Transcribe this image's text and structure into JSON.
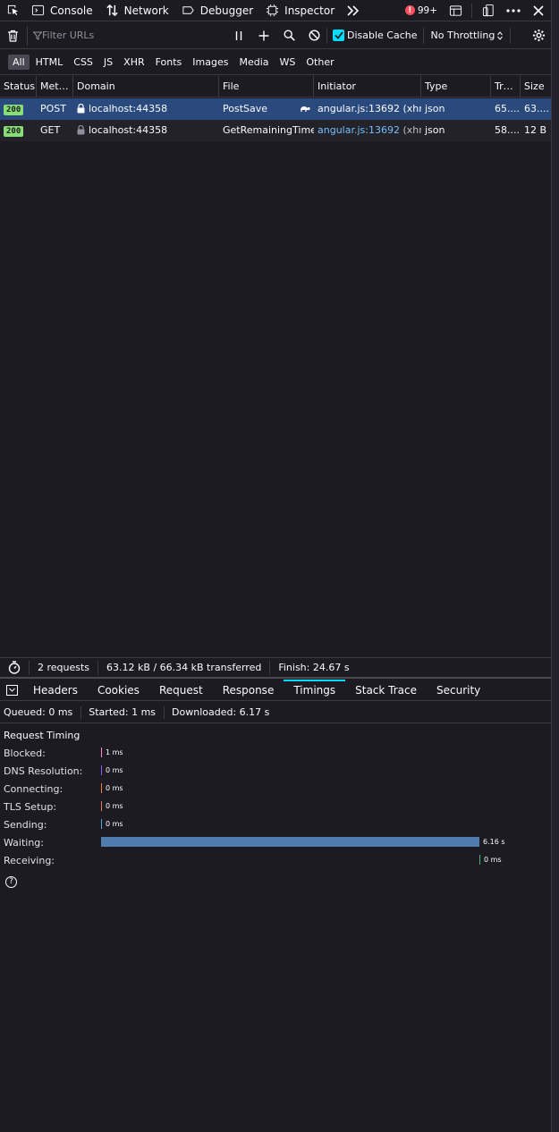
{
  "toolbox": {
    "tabs": [
      {
        "label": "Console",
        "icon": "console-icon"
      },
      {
        "label": "Network",
        "icon": "network-icon",
        "active": true
      },
      {
        "label": "Debugger",
        "icon": "debugger-icon"
      },
      {
        "label": "Inspector",
        "icon": "inspector-icon"
      }
    ],
    "error_count": "99+"
  },
  "filterbar": {
    "placeholder": "Filter URLs",
    "disable_cache_label": "Disable Cache",
    "disable_cache_checked": true,
    "throttling_label": "No Throttling"
  },
  "type_filters": [
    "All",
    "HTML",
    "CSS",
    "JS",
    "XHR",
    "Fonts",
    "Images",
    "Media",
    "WS",
    "Other"
  ],
  "table": {
    "columns": [
      "Status",
      "Met…",
      "Domain",
      "File",
      "Initiator",
      "Type",
      "Tr…",
      "Size"
    ],
    "rows": [
      {
        "status": "200",
        "method": "POST",
        "domain": "localhost:44358",
        "file": "PostSave",
        "initiator": "angular.js:13692",
        "initiator_suffix": "(xhr)",
        "type": "json",
        "transferred": "65....",
        "size": "63....",
        "selected": true
      },
      {
        "status": "200",
        "method": "GET",
        "domain": "localhost:44358",
        "file": "GetRemainingTimes",
        "initiator": "angular.js:13692",
        "initiator_suffix": "(xhr)",
        "type": "json",
        "transferred": "58....",
        "size": "12 B",
        "selected": false
      }
    ]
  },
  "summary": {
    "requests": "2 requests",
    "transferred": "63.12 kB / 66.34 kB transferred",
    "finish": "Finish: 24.67 s"
  },
  "details": {
    "tabs": [
      "Headers",
      "Cookies",
      "Request",
      "Response",
      "Timings",
      "Stack Trace",
      "Security"
    ],
    "active_tab": "Timings",
    "queued": "Queued: 0 ms",
    "started": "Started: 1 ms",
    "downloaded": "Downloaded: 6.17 s",
    "request_timing_title": "Request Timing",
    "timings": [
      {
        "label": "Blocked:",
        "value": "1 ms",
        "fraction": 0.0,
        "color": "#ff8bd2"
      },
      {
        "label": "DNS Resolution:",
        "value": "0 ms",
        "fraction": 0.0,
        "color": "#9059ff"
      },
      {
        "label": "Connecting:",
        "value": "0 ms",
        "fraction": 0.0,
        "color": "#ff7f40"
      },
      {
        "label": "TLS Setup:",
        "value": "0 ms",
        "fraction": 0.0,
        "color": "#e3795a"
      },
      {
        "label": "Sending:",
        "value": "0 ms",
        "fraction": 0.0,
        "color": "#52a6e0"
      },
      {
        "label": "Waiting:",
        "value": "6.16 s",
        "fraction": 1.0,
        "color": "#4f7cac"
      },
      {
        "label": "Receiving:",
        "value": "0 ms",
        "fraction": 0.0,
        "color": "#3fb27f"
      }
    ]
  }
}
